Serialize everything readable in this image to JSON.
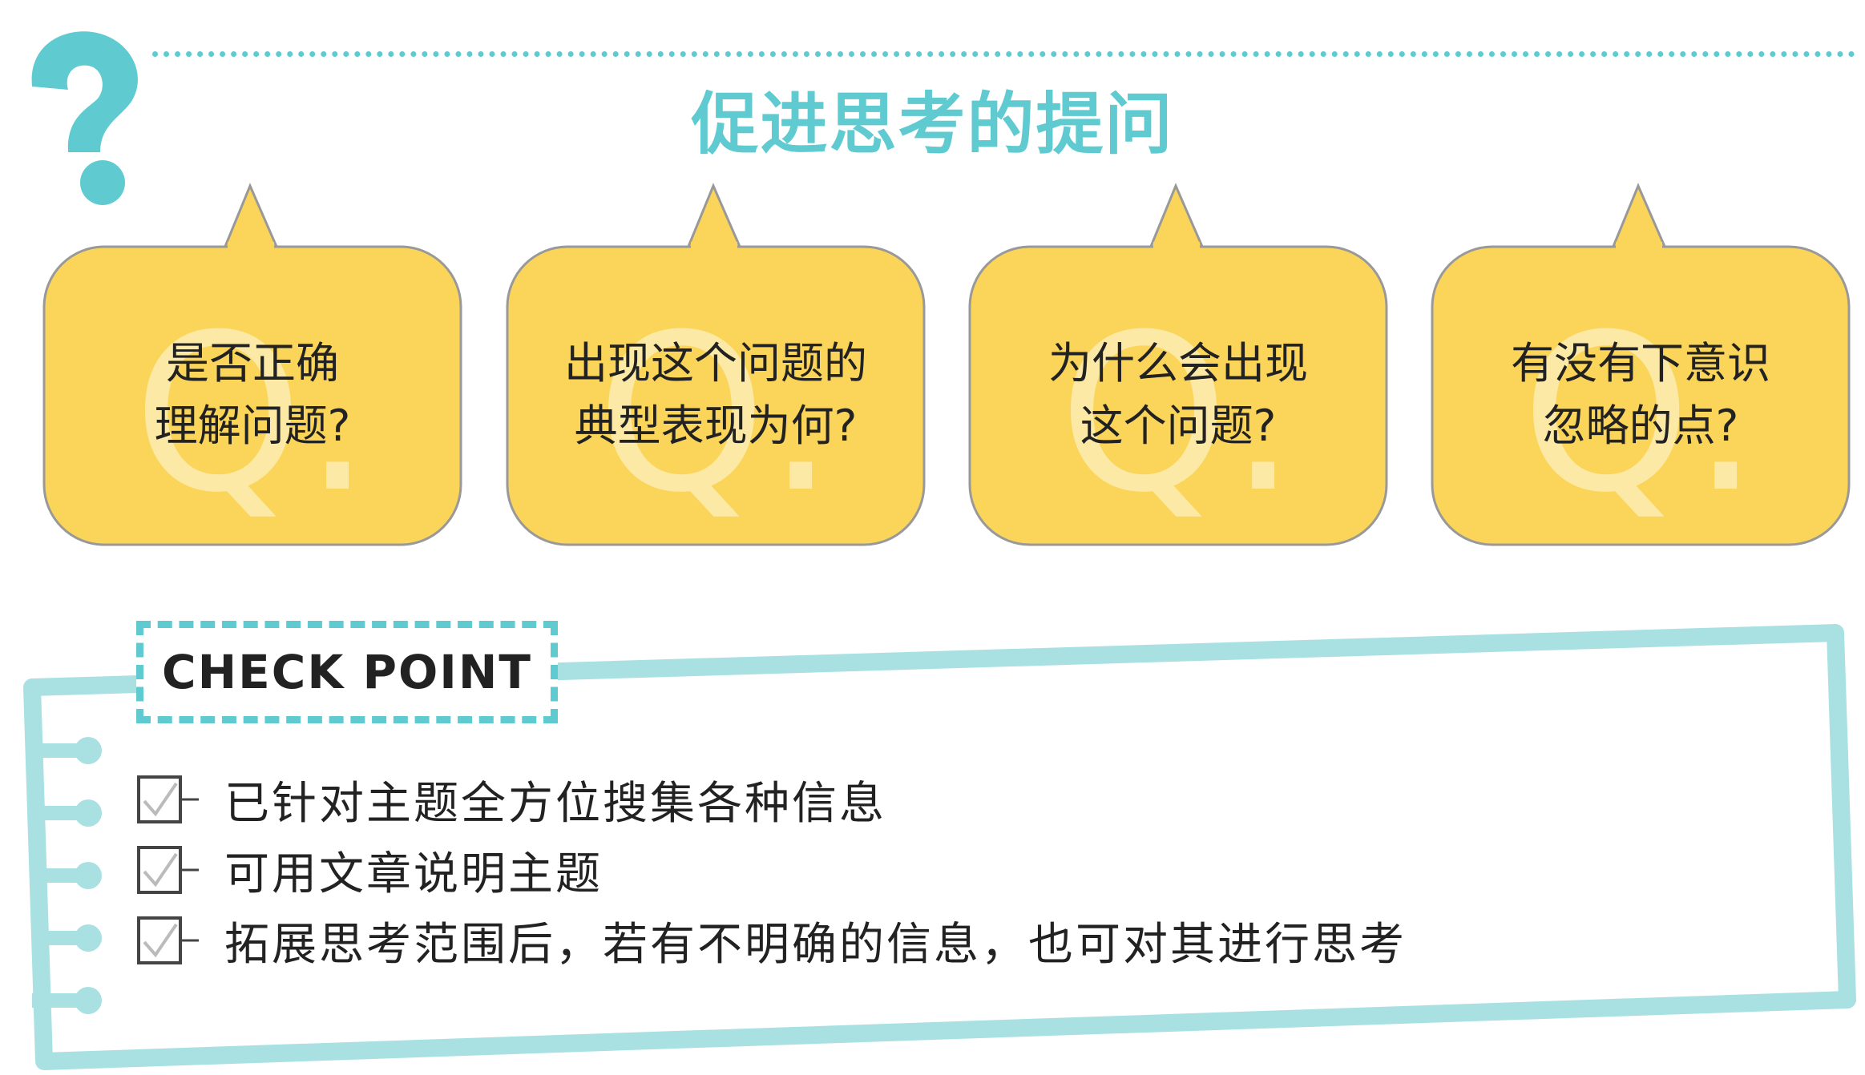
{
  "header": {
    "title": "促进思考的提问",
    "icon": "question-mark-icon",
    "accent_color": "#5fcbd0"
  },
  "questions": [
    {
      "mark": "Q.",
      "line1": "是否正确",
      "line2": "理解问题?"
    },
    {
      "mark": "Q.",
      "line1": "出现这个问题的",
      "line2": "典型表现为何?"
    },
    {
      "mark": "Q.",
      "line1": "为什么会出现",
      "line2": "这个问题?"
    },
    {
      "mark": "Q.",
      "line1": "有没有下意识",
      "line2": "忽略的点?"
    }
  ],
  "bubble_color": "#fbd55a",
  "check_point": {
    "title": "CHECK POINT",
    "items": [
      {
        "text": "已针对主题全方位搜集各种信息",
        "icon": "checkbox-icon"
      },
      {
        "text": "可用文章说明主题",
        "icon": "checkbox-icon"
      },
      {
        "text": "拓展思考范围后，若有不明确的信息，也可对其进行思考",
        "icon": "checkbox-icon"
      }
    ],
    "frame_color": "#a9e0e2"
  }
}
